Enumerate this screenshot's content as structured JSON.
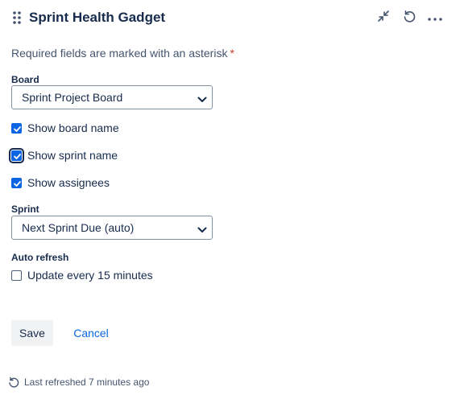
{
  "header": {
    "title": "Sprint Health Gadget",
    "icons": [
      "drag-handle-icon",
      "minimize-icon",
      "refresh-icon",
      "more-icon"
    ]
  },
  "form": {
    "required_note": "Required fields are marked with an asterisk",
    "required_marker": "*",
    "board": {
      "label": "Board",
      "value": "Sprint Project Board"
    },
    "checkboxes": [
      {
        "label": "Show board name",
        "checked": true
      },
      {
        "label": "Show sprint name",
        "checked": true,
        "focused": true
      },
      {
        "label": "Show assignees",
        "checked": true
      }
    ],
    "sprint": {
      "label": "Sprint",
      "value": "Next Sprint Due (auto)"
    },
    "auto_refresh": {
      "label": "Auto refresh",
      "option_label": "Update every 15 minutes",
      "checked": false
    }
  },
  "actions": {
    "save_label": "Save",
    "cancel_label": "Cancel"
  },
  "footer": {
    "last_refreshed": "Last refreshed 7 minutes ago"
  },
  "colors": {
    "primary": "#0c66e4",
    "text": "#172b4d",
    "subtle_text": "#44546f",
    "required": "#c9372c",
    "button_bg": "#f1f2f4"
  }
}
